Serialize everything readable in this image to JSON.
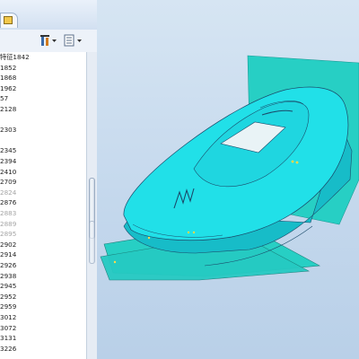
{
  "tree": {
    "items": [
      {
        "label": "特征1842",
        "dim": false
      },
      {
        "label": "1852",
        "dim": false
      },
      {
        "label": "1868",
        "dim": false
      },
      {
        "label": "1962",
        "dim": false
      },
      {
        "label": "57",
        "dim": false
      },
      {
        "label": "2128",
        "dim": false
      },
      {
        "label": "",
        "dim": false
      },
      {
        "label": "2303",
        "dim": false
      },
      {
        "label": "",
        "dim": false
      },
      {
        "label": "2345",
        "dim": false
      },
      {
        "label": "2394",
        "dim": false
      },
      {
        "label": "2410",
        "dim": false
      },
      {
        "label": "2709",
        "dim": false
      },
      {
        "label": "2824",
        "dim": true
      },
      {
        "label": "2876",
        "dim": false
      },
      {
        "label": "2883",
        "dim": true
      },
      {
        "label": "2889",
        "dim": true
      },
      {
        "label": "2895",
        "dim": true
      },
      {
        "label": "2902",
        "dim": false
      },
      {
        "label": "2914",
        "dim": false
      },
      {
        "label": "2926",
        "dim": false
      },
      {
        "label": "2938",
        "dim": false
      },
      {
        "label": "2945",
        "dim": false
      },
      {
        "label": "2952",
        "dim": false
      },
      {
        "label": "2959",
        "dim": false
      },
      {
        "label": "3012",
        "dim": false
      },
      {
        "label": "3072",
        "dim": false
      },
      {
        "label": "3131",
        "dim": false
      },
      {
        "label": "3226",
        "dim": false
      }
    ]
  },
  "colors": {
    "panel_bg": "#dbe7f4",
    "model_fill": "#21e0e8",
    "model_shadow": "#17bcc8",
    "sheet": "#29d2c8",
    "edge": "#1b4a6a"
  },
  "icons": {
    "tab_icon": "star-tab-icon",
    "tool1": "filter-icon",
    "tool2": "settings-list-icon"
  }
}
